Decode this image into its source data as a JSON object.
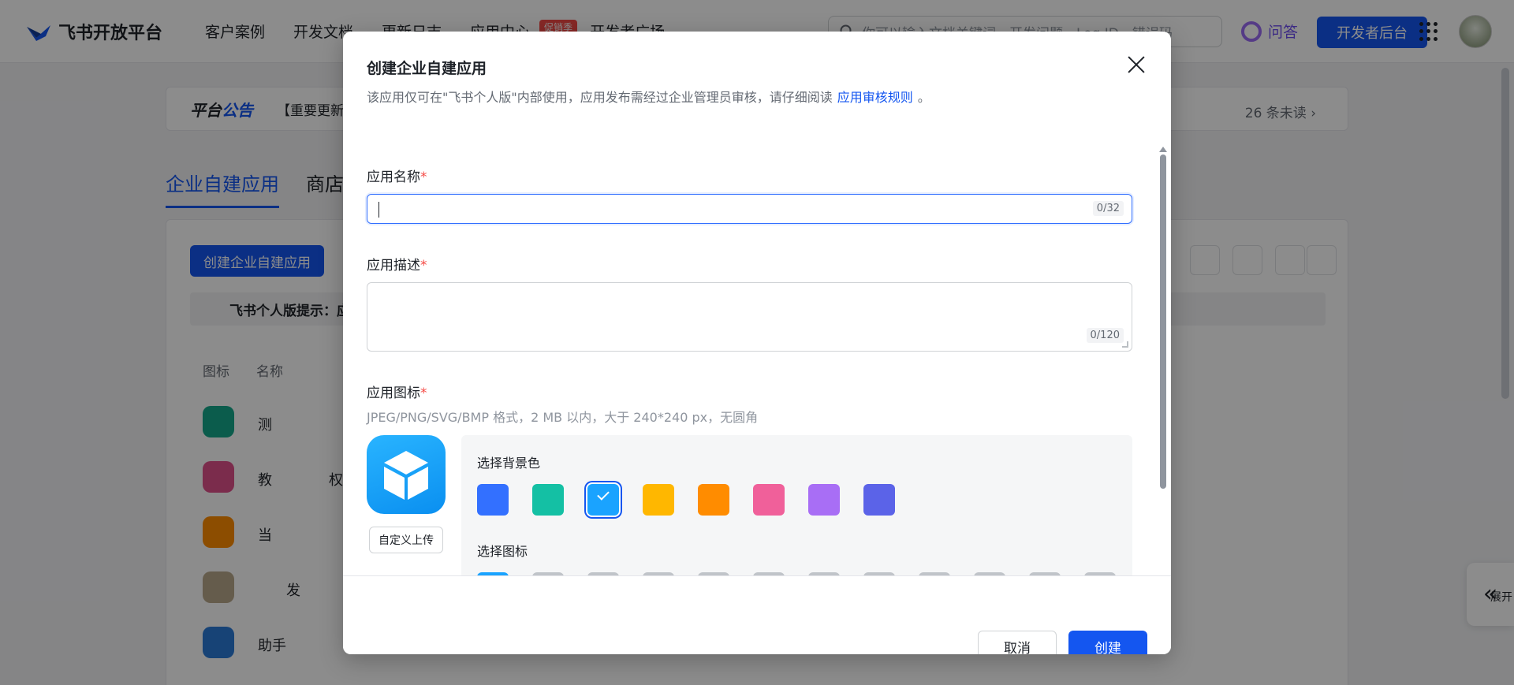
{
  "topnav": {
    "logo_text": "飞书开放平台",
    "links": [
      "客户案例",
      "开发文档",
      "更新日志",
      "应用中心",
      "开发者广场"
    ],
    "badge": "促销季",
    "search_placeholder": "你可以输入文档关键词、开发问题、Log ID、错误码",
    "qa_label": "问答",
    "dev_console": "开发者后台"
  },
  "announce": {
    "title_a": "平台",
    "title_b": "公告",
    "text": "【重要更新",
    "unread": "26 条未读 ›"
  },
  "tabs": [
    "企业自建应用",
    "商店"
  ],
  "card": {
    "create_button": "创建企业自建应用",
    "tip": "飞书个人版提示：应",
    "columns": [
      "图标",
      "名称"
    ],
    "rows": [
      "测",
      "教　　　　权",
      "当",
      "　　发",
      "助手"
    ]
  },
  "expand_label": "展开",
  "modal": {
    "title": "创建企业自建应用",
    "subtitle": "该应用仅可在\"飞书个人版\"内部使用，应用发布需经过企业管理员审核，请仔细阅读",
    "subtitle_link": "应用审核规则",
    "subtitle_end": "。",
    "name_label": "应用名称",
    "name_value": "",
    "name_counter": "0/32",
    "desc_label": "应用描述",
    "desc_value": "",
    "desc_counter": "0/120",
    "icon_label": "应用图标",
    "icon_hint": "JPEG/PNG/SVG/BMP 格式，2 MB 以内，大于 240*240 px，无圆角",
    "upload_button": "自定义上传",
    "bg_color_label": "选择背景色",
    "bg_colors": [
      "#3370ff",
      "#14c0a4",
      "#1aa3ff",
      "#ffb700",
      "#ff8c00",
      "#f0609a",
      "#a86ef5",
      "#5b63e8"
    ],
    "selected_bg_index": 2,
    "icon_choice_label": "选择图标",
    "icons": [
      "cube-icon",
      "robot-icon",
      "bulb-icon",
      "door-icon",
      "briefcase-icon",
      "bell-icon",
      "bookmark-check-icon",
      "moon-icon",
      "star-badge-icon",
      "tag-icon",
      "wrench-icon",
      "document-icon"
    ],
    "selected_icon_index": 0,
    "cancel": "取消",
    "create": "创建"
  }
}
